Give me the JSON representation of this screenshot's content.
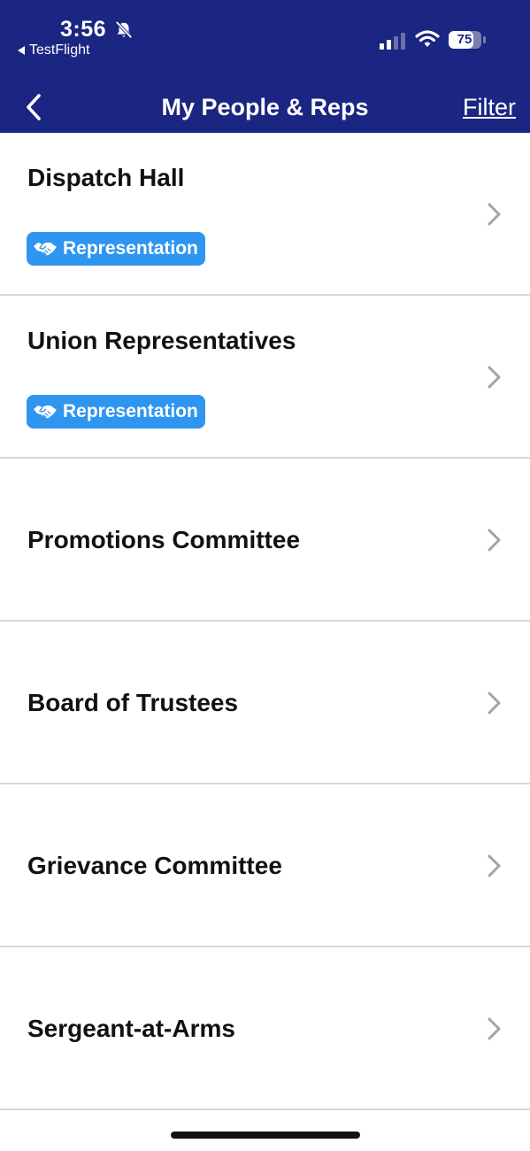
{
  "status_bar": {
    "time": "3:56",
    "back_app": "TestFlight",
    "battery": "75",
    "icons": [
      "bell-slash-icon",
      "signal-icon",
      "wifi-icon",
      "battery-icon"
    ]
  },
  "nav": {
    "title": "My People & Reps",
    "filter_label": "Filter",
    "back_icon": "chevron-left-icon"
  },
  "colors": {
    "header_bg": "#1b2582",
    "badge_bg": "#2e95f0",
    "divider": "#d6d6d6",
    "chevron": "#a3a3a3"
  },
  "items": [
    {
      "title": "Dispatch Hall",
      "badge": "Representation",
      "badge_icon": "handshake-icon"
    },
    {
      "title": "Union Representatives",
      "badge": "Representation",
      "badge_icon": "handshake-icon"
    },
    {
      "title": "Promotions Committee"
    },
    {
      "title": "Board of Trustees"
    },
    {
      "title": "Grievance Committee"
    },
    {
      "title": "Sergeant-at-Arms"
    }
  ]
}
